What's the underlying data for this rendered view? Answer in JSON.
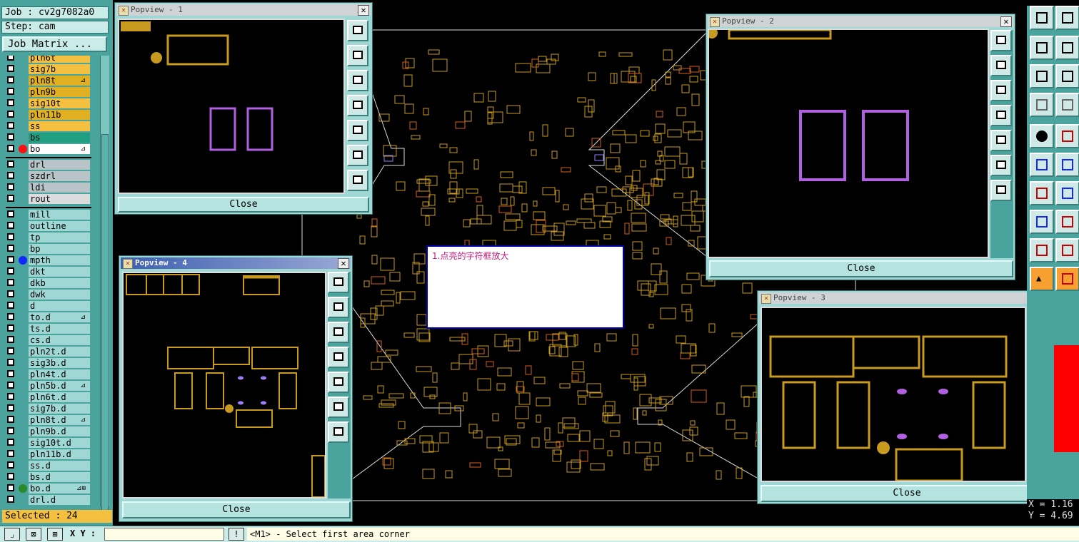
{
  "left_panel": {
    "job_line": "Job : cv2g7082a0",
    "step_line": "Step: cam",
    "job_matrix_label": "Job Matrix ...",
    "selected_line": "Selected : 24",
    "layer_groups": [
      [
        {
          "name": "pln6t",
          "color": "#f5c040"
        },
        {
          "name": "sig7b",
          "color": "#f5c040"
        },
        {
          "name": "pln8t",
          "color": "#e0b020",
          "flag": "⊿"
        },
        {
          "name": "pln9b",
          "color": "#e0b020"
        },
        {
          "name": "sig10t",
          "color": "#f5c040"
        },
        {
          "name": "pln11b",
          "color": "#e0b020"
        },
        {
          "name": "ss",
          "color": "#f5c040"
        },
        {
          "name": "bs",
          "color": "#1f9e80"
        },
        {
          "name": "bo",
          "color": "#ffffff",
          "flag": "⊿",
          "dot": "#ff1010"
        }
      ],
      [
        {
          "name": "drl",
          "color": "#b8c4c8"
        },
        {
          "name": "szdrl",
          "color": "#b8c4c8"
        },
        {
          "name": "ldi",
          "color": "#b8c4c8"
        },
        {
          "name": "rout",
          "color": "#dcdcdc"
        }
      ],
      [
        {
          "name": "mill",
          "color": "#9ed7d3"
        },
        {
          "name": "outline",
          "color": "#9ed7d3"
        },
        {
          "name": "tp",
          "color": "#9ed7d3"
        },
        {
          "name": "bp",
          "color": "#9ed7d3"
        },
        {
          "name": "mpth",
          "color": "#9ed7d3",
          "dot": "#1028ff"
        },
        {
          "name": "dkt",
          "color": "#9ed7d3"
        },
        {
          "name": "dkb",
          "color": "#9ed7d3"
        },
        {
          "name": "dwk",
          "color": "#9ed7d3"
        },
        {
          "name": "d",
          "color": "#9ed7d3"
        },
        {
          "name": "to.d",
          "color": "#9ed7d3",
          "flag": "⊿"
        },
        {
          "name": "ts.d",
          "color": "#9ed7d3"
        },
        {
          "name": "cs.d",
          "color": "#9ed7d3"
        },
        {
          "name": "pln2t.d",
          "color": "#9ed7d3"
        },
        {
          "name": "sig3b.d",
          "color": "#9ed7d3"
        },
        {
          "name": "pln4t.d",
          "color": "#9ed7d3"
        },
        {
          "name": "pln5b.d",
          "color": "#9ed7d3",
          "flag": "⊿"
        },
        {
          "name": "pln6t.d",
          "color": "#9ed7d3"
        },
        {
          "name": "sig7b.d",
          "color": "#9ed7d3"
        },
        {
          "name": "pln8t.d",
          "color": "#9ed7d3",
          "flag": "⊿"
        },
        {
          "name": "pln9b.d",
          "color": "#9ed7d3"
        },
        {
          "name": "sig10t.d",
          "color": "#9ed7d3"
        },
        {
          "name": "pln11b.d",
          "color": "#9ed7d3"
        },
        {
          "name": "ss.d",
          "color": "#9ed7d3"
        },
        {
          "name": "bs.d",
          "color": "#9ed7d3"
        },
        {
          "name": "bo.d",
          "color": "#9ed7d3",
          "flag": "⊿⊞",
          "dot": "#2a8a2a"
        },
        {
          "name": "drl.d",
          "color": "#9ed7d3"
        }
      ]
    ]
  },
  "popups": {
    "p1": {
      "title": "Popview - 1",
      "close": "Close"
    },
    "p2": {
      "title": "Popview - 2",
      "close": "Close"
    },
    "p3": {
      "title": "Popview - 3",
      "close": "Close"
    },
    "p4": {
      "title": "Popview - 4",
      "close": "Close"
    }
  },
  "annotation": "1.点亮的字符框放大",
  "coords": {
    "x": "X = 1.16",
    "y": "Y = 4.69"
  },
  "bottom": {
    "xy_label": "X Y :",
    "message": "<M1> - Select first area corner"
  },
  "colors": {
    "pad": "#c89a20",
    "pad_selected": "#b060e0",
    "panel": "#9ed7d3"
  }
}
